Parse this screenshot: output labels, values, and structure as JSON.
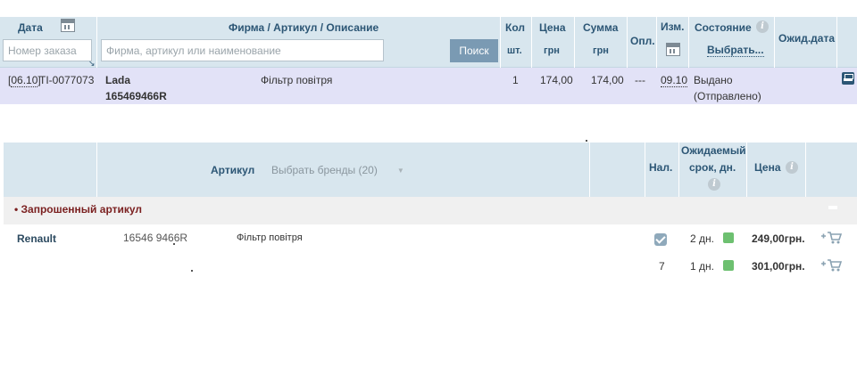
{
  "orders_table": {
    "headers": {
      "date": "Дата",
      "firm": "Фирма / Артикул / Описание",
      "qty": "Кол",
      "qty_unit": "шт.",
      "price": "Цена",
      "price_unit": "грн",
      "sum": "Сумма",
      "sum_unit": "грн",
      "paid": "Опл.",
      "changed": "Изм.",
      "status": "Состояние",
      "status_select": "Выбрать...",
      "expected": "Ожид.дата"
    },
    "filters": {
      "order_number_placeholder": "Номер заказа",
      "search_placeholder": "Фирма, артикул или наименование",
      "search_button": "Поиск"
    },
    "rows": [
      {
        "date": "06.10",
        "order_id": "TI-0077073",
        "brand": "Lada",
        "article": "165469466R",
        "description": "Фільтр повітря",
        "qty": "1",
        "price": "174,00",
        "sum": "174,00",
        "paid": "---",
        "changed": "09.10",
        "status": "Выдано",
        "status_detail": "(Отправлено)"
      }
    ]
  },
  "results_table": {
    "headers": {
      "article": "Артикул",
      "brand_filter": "Выбрать бренды (20)",
      "availability": "Нал.",
      "expected_line1": "Ожидаемый",
      "expected_line2": "срок, дн.",
      "price": "Цена"
    },
    "section_title": "• Запрошенный артикул",
    "rows": [
      {
        "brand": "Renault",
        "article": "16546 9466R",
        "description": "Фільтр повітря",
        "availability_checked": true,
        "availability": "",
        "term": "2 дн.",
        "price": "249,00грн."
      },
      {
        "brand": "",
        "article": "",
        "description": "",
        "availability_checked": false,
        "availability": "7",
        "term": "1 дн.",
        "price": "301,00грн."
      }
    ]
  },
  "icons": {
    "calendar": "calendar-icon",
    "info": "info-icon",
    "car": "car-icon",
    "cart": "add-to-cart-icon",
    "check": "checkbox-checked-icon"
  },
  "colors": {
    "header_bg": "#d8e6ee",
    "header_text": "#2c5675",
    "order_row_bg": "#e2e2f7",
    "search_button_bg": "#7a9ab3",
    "section_title": "#7a1f1f",
    "status_ok": "#6dc070"
  }
}
